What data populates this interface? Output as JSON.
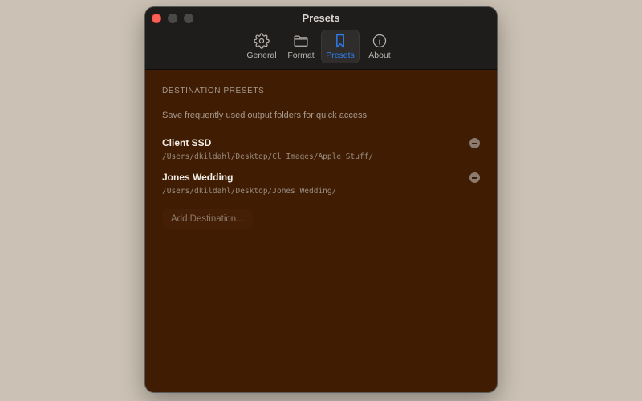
{
  "window": {
    "title": "Presets"
  },
  "toolbar": {
    "tabs": [
      {
        "label": "General",
        "icon": "gear-icon",
        "active": false
      },
      {
        "label": "Format",
        "icon": "folder-icon",
        "active": false
      },
      {
        "label": "Presets",
        "icon": "bookmark-icon",
        "active": true
      },
      {
        "label": "About",
        "icon": "info-icon",
        "active": false
      }
    ]
  },
  "content": {
    "heading": "DESTINATION PRESETS",
    "description": "Save frequently used output folders for quick access.",
    "presets": [
      {
        "name": "Client SSD",
        "path": "/Users/dkildahl/Desktop/Cl Images/Apple Stuff/"
      },
      {
        "name": "Jones Wedding",
        "path": "/Users/dkildahl/Desktop/Jones Wedding/"
      }
    ],
    "add_label": "Add Destination..."
  },
  "colors": {
    "background": "#cbc1b4",
    "titlebar": "#1f1d1c",
    "content_bg": "#3f1c02",
    "accent": "#2f7ff5",
    "close_button": "#fe5f57"
  }
}
